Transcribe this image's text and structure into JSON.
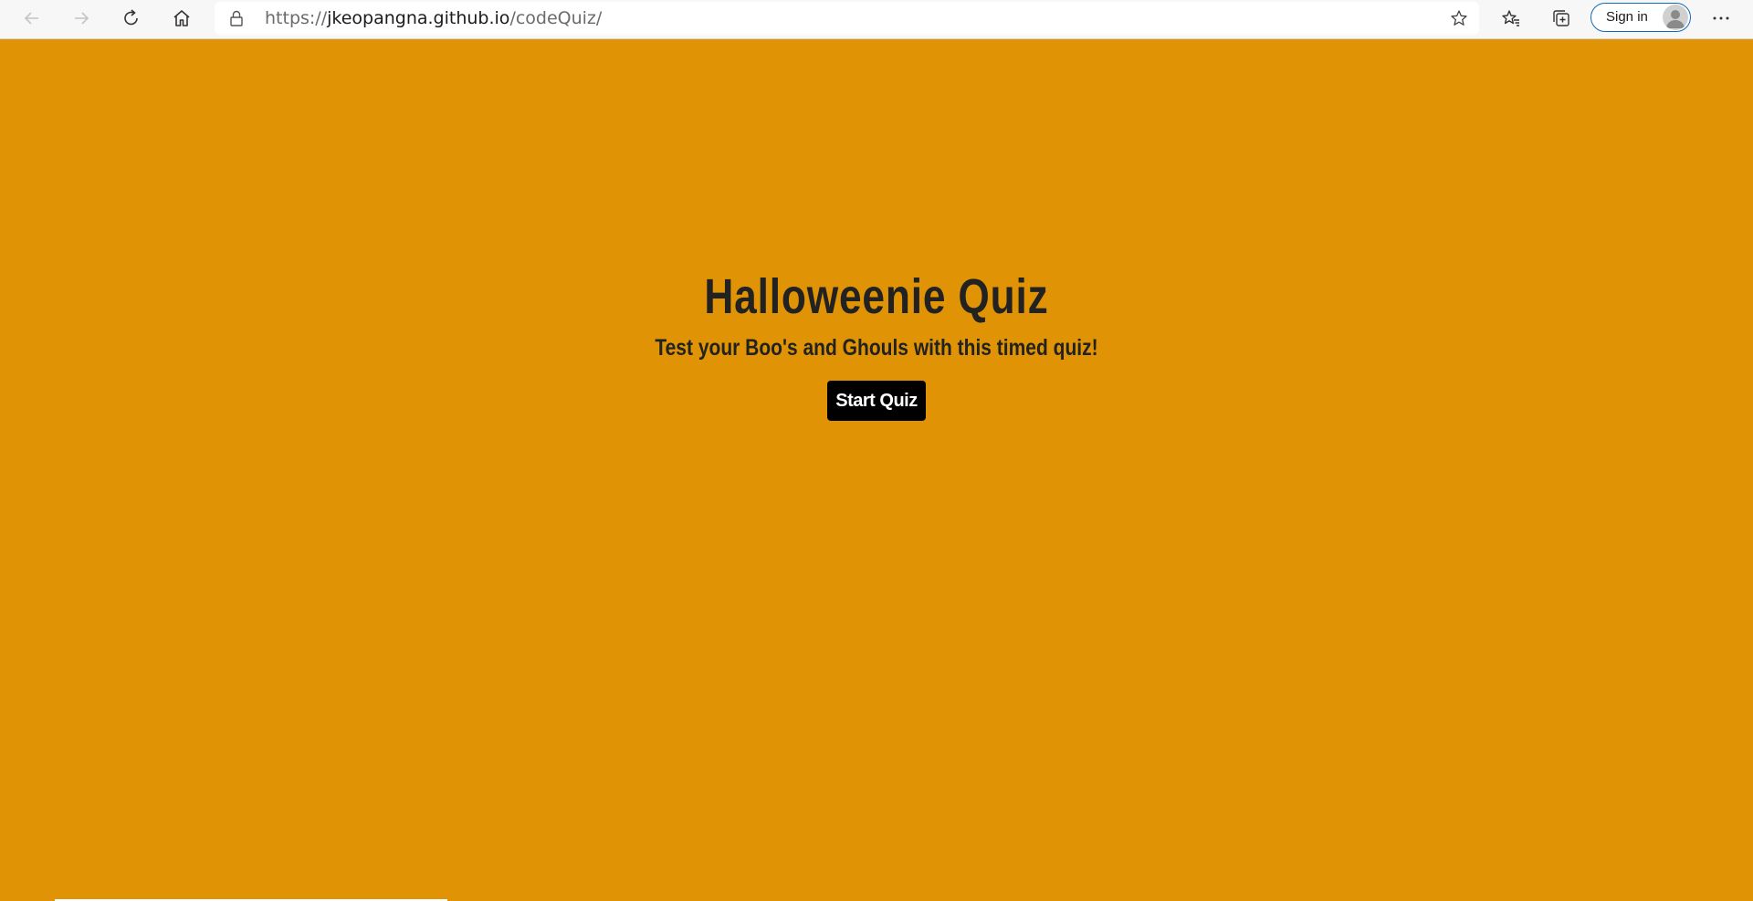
{
  "browser": {
    "url_scheme": "https://",
    "url_host": "jkeopangna.github.io",
    "url_path": "/codeQuiz/",
    "sign_in_label": "Sign in",
    "icons": {
      "back": "back-arrow-icon",
      "forward": "forward-arrow-icon",
      "refresh": "refresh-icon",
      "home": "home-icon",
      "lock": "lock-icon",
      "favorite": "star-icon",
      "favorites": "favorites-icon",
      "collections": "collections-icon",
      "avatar": "avatar-icon",
      "more": "more-icon"
    }
  },
  "page": {
    "background_color": "#e09405",
    "title": "Halloweenie Quiz",
    "subtitle": "Test your Boo's and Ghouls with this timed quiz!",
    "start_button_label": "Start Quiz"
  }
}
